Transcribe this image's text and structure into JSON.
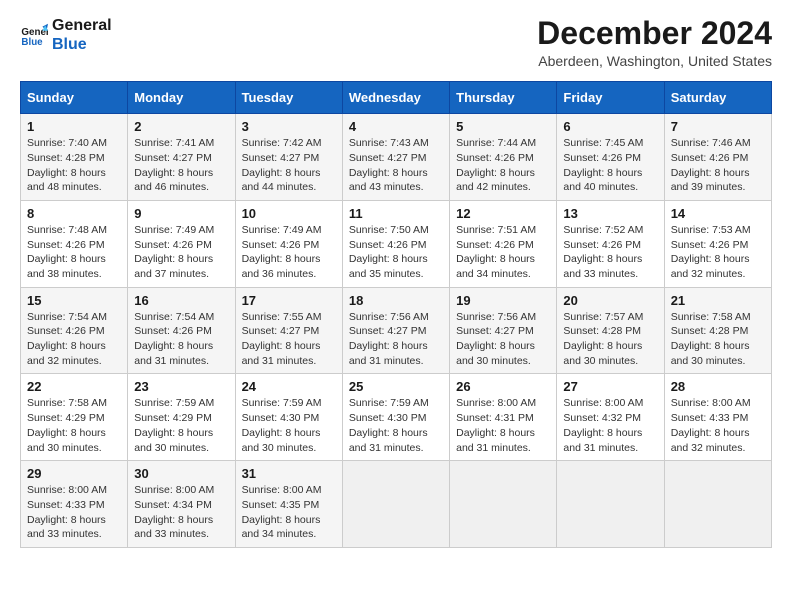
{
  "logo": {
    "line1": "General",
    "line2": "Blue"
  },
  "title": "December 2024",
  "subtitle": "Aberdeen, Washington, United States",
  "headers": [
    "Sunday",
    "Monday",
    "Tuesday",
    "Wednesday",
    "Thursday",
    "Friday",
    "Saturday"
  ],
  "weeks": [
    [
      {
        "day": "1",
        "sunrise": "Sunrise: 7:40 AM",
        "sunset": "Sunset: 4:28 PM",
        "daylight": "Daylight: 8 hours and 48 minutes."
      },
      {
        "day": "2",
        "sunrise": "Sunrise: 7:41 AM",
        "sunset": "Sunset: 4:27 PM",
        "daylight": "Daylight: 8 hours and 46 minutes."
      },
      {
        "day": "3",
        "sunrise": "Sunrise: 7:42 AM",
        "sunset": "Sunset: 4:27 PM",
        "daylight": "Daylight: 8 hours and 44 minutes."
      },
      {
        "day": "4",
        "sunrise": "Sunrise: 7:43 AM",
        "sunset": "Sunset: 4:27 PM",
        "daylight": "Daylight: 8 hours and 43 minutes."
      },
      {
        "day": "5",
        "sunrise": "Sunrise: 7:44 AM",
        "sunset": "Sunset: 4:26 PM",
        "daylight": "Daylight: 8 hours and 42 minutes."
      },
      {
        "day": "6",
        "sunrise": "Sunrise: 7:45 AM",
        "sunset": "Sunset: 4:26 PM",
        "daylight": "Daylight: 8 hours and 40 minutes."
      },
      {
        "day": "7",
        "sunrise": "Sunrise: 7:46 AM",
        "sunset": "Sunset: 4:26 PM",
        "daylight": "Daylight: 8 hours and 39 minutes."
      }
    ],
    [
      {
        "day": "8",
        "sunrise": "Sunrise: 7:48 AM",
        "sunset": "Sunset: 4:26 PM",
        "daylight": "Daylight: 8 hours and 38 minutes."
      },
      {
        "day": "9",
        "sunrise": "Sunrise: 7:49 AM",
        "sunset": "Sunset: 4:26 PM",
        "daylight": "Daylight: 8 hours and 37 minutes."
      },
      {
        "day": "10",
        "sunrise": "Sunrise: 7:49 AM",
        "sunset": "Sunset: 4:26 PM",
        "daylight": "Daylight: 8 hours and 36 minutes."
      },
      {
        "day": "11",
        "sunrise": "Sunrise: 7:50 AM",
        "sunset": "Sunset: 4:26 PM",
        "daylight": "Daylight: 8 hours and 35 minutes."
      },
      {
        "day": "12",
        "sunrise": "Sunrise: 7:51 AM",
        "sunset": "Sunset: 4:26 PM",
        "daylight": "Daylight: 8 hours and 34 minutes."
      },
      {
        "day": "13",
        "sunrise": "Sunrise: 7:52 AM",
        "sunset": "Sunset: 4:26 PM",
        "daylight": "Daylight: 8 hours and 33 minutes."
      },
      {
        "day": "14",
        "sunrise": "Sunrise: 7:53 AM",
        "sunset": "Sunset: 4:26 PM",
        "daylight": "Daylight: 8 hours and 32 minutes."
      }
    ],
    [
      {
        "day": "15",
        "sunrise": "Sunrise: 7:54 AM",
        "sunset": "Sunset: 4:26 PM",
        "daylight": "Daylight: 8 hours and 32 minutes."
      },
      {
        "day": "16",
        "sunrise": "Sunrise: 7:54 AM",
        "sunset": "Sunset: 4:26 PM",
        "daylight": "Daylight: 8 hours and 31 minutes."
      },
      {
        "day": "17",
        "sunrise": "Sunrise: 7:55 AM",
        "sunset": "Sunset: 4:27 PM",
        "daylight": "Daylight: 8 hours and 31 minutes."
      },
      {
        "day": "18",
        "sunrise": "Sunrise: 7:56 AM",
        "sunset": "Sunset: 4:27 PM",
        "daylight": "Daylight: 8 hours and 31 minutes."
      },
      {
        "day": "19",
        "sunrise": "Sunrise: 7:56 AM",
        "sunset": "Sunset: 4:27 PM",
        "daylight": "Daylight: 8 hours and 30 minutes."
      },
      {
        "day": "20",
        "sunrise": "Sunrise: 7:57 AM",
        "sunset": "Sunset: 4:28 PM",
        "daylight": "Daylight: 8 hours and 30 minutes."
      },
      {
        "day": "21",
        "sunrise": "Sunrise: 7:58 AM",
        "sunset": "Sunset: 4:28 PM",
        "daylight": "Daylight: 8 hours and 30 minutes."
      }
    ],
    [
      {
        "day": "22",
        "sunrise": "Sunrise: 7:58 AM",
        "sunset": "Sunset: 4:29 PM",
        "daylight": "Daylight: 8 hours and 30 minutes."
      },
      {
        "day": "23",
        "sunrise": "Sunrise: 7:59 AM",
        "sunset": "Sunset: 4:29 PM",
        "daylight": "Daylight: 8 hours and 30 minutes."
      },
      {
        "day": "24",
        "sunrise": "Sunrise: 7:59 AM",
        "sunset": "Sunset: 4:30 PM",
        "daylight": "Daylight: 8 hours and 30 minutes."
      },
      {
        "day": "25",
        "sunrise": "Sunrise: 7:59 AM",
        "sunset": "Sunset: 4:30 PM",
        "daylight": "Daylight: 8 hours and 31 minutes."
      },
      {
        "day": "26",
        "sunrise": "Sunrise: 8:00 AM",
        "sunset": "Sunset: 4:31 PM",
        "daylight": "Daylight: 8 hours and 31 minutes."
      },
      {
        "day": "27",
        "sunrise": "Sunrise: 8:00 AM",
        "sunset": "Sunset: 4:32 PM",
        "daylight": "Daylight: 8 hours and 31 minutes."
      },
      {
        "day": "28",
        "sunrise": "Sunrise: 8:00 AM",
        "sunset": "Sunset: 4:33 PM",
        "daylight": "Daylight: 8 hours and 32 minutes."
      }
    ],
    [
      {
        "day": "29",
        "sunrise": "Sunrise: 8:00 AM",
        "sunset": "Sunset: 4:33 PM",
        "daylight": "Daylight: 8 hours and 33 minutes."
      },
      {
        "day": "30",
        "sunrise": "Sunrise: 8:00 AM",
        "sunset": "Sunset: 4:34 PM",
        "daylight": "Daylight: 8 hours and 33 minutes."
      },
      {
        "day": "31",
        "sunrise": "Sunrise: 8:00 AM",
        "sunset": "Sunset: 4:35 PM",
        "daylight": "Daylight: 8 hours and 34 minutes."
      },
      null,
      null,
      null,
      null
    ]
  ]
}
